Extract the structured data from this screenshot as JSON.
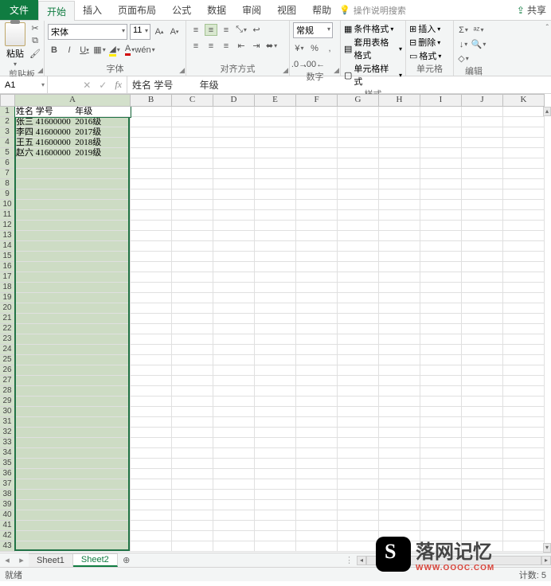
{
  "menu": {
    "tabs": [
      "文件",
      "开始",
      "插入",
      "页面布局",
      "公式",
      "数据",
      "审阅",
      "视图",
      "帮助"
    ],
    "tell_me": "操作说明搜索",
    "share": "共享"
  },
  "ribbon": {
    "clipboard": {
      "paste": "粘贴",
      "label": "剪贴板"
    },
    "font": {
      "name": "宋体",
      "size": "11",
      "label": "字体"
    },
    "align": {
      "label": "对齐方式"
    },
    "number": {
      "format": "常规",
      "label": "数字"
    },
    "styles": {
      "cond": "条件格式",
      "tablefmt": "套用表格格式",
      "cellstyle": "单元格样式",
      "label": "样式"
    },
    "cells": {
      "insert": "插入",
      "delete": "删除",
      "format": "格式",
      "label": "单元格"
    },
    "editing": {
      "label": "编辑"
    }
  },
  "namebox": "A1",
  "formula_bar": "姓名 学号          年级",
  "columns": [
    "A",
    "B",
    "C",
    "D",
    "E",
    "F",
    "G",
    "H",
    "I",
    "J",
    "K"
  ],
  "row_count": 43,
  "data": {
    "r1": "姓名 学号          年级",
    "r2": "张三 41600000  2016级",
    "r3": "李四 41600000  2017级",
    "r4": "王五 41600000  2018级",
    "r5": "赵六 41600000  2019级"
  },
  "sheets": {
    "s1": "Sheet1",
    "s2": "Sheet2"
  },
  "status": {
    "ready": "就绪",
    "count": "计数: 5"
  },
  "watermark": {
    "brand": "落网记忆",
    "url": "WWW.OOOC.COM"
  }
}
